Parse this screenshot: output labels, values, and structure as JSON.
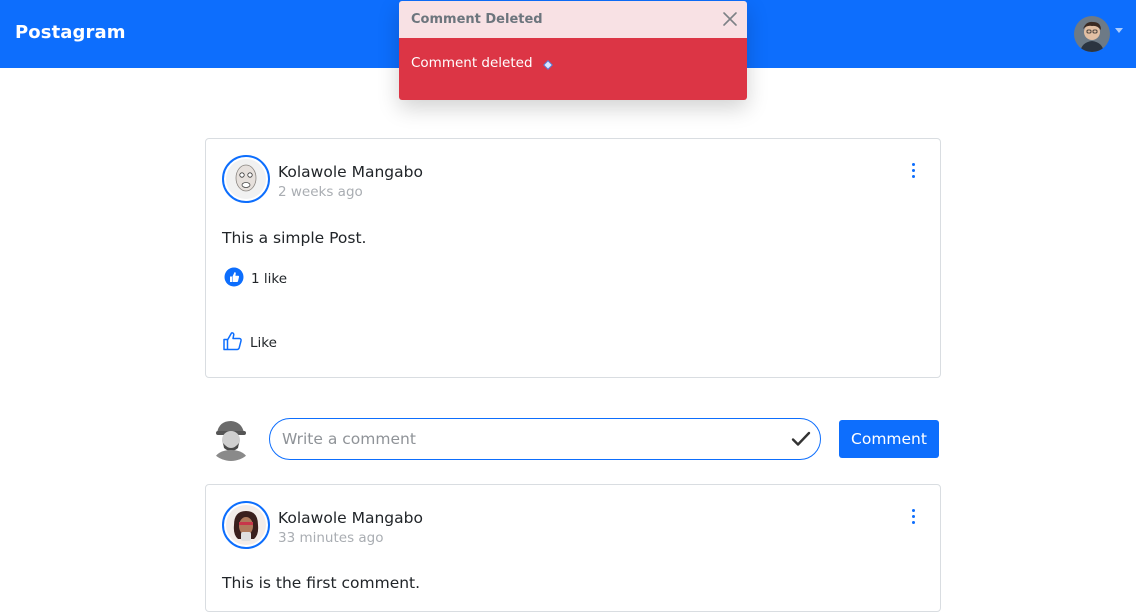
{
  "navbar": {
    "brand": "Postagram",
    "avatar_icon": "user-avatar-icon",
    "caret_icon": "caret-down-icon"
  },
  "toast": {
    "title": "Comment Deleted",
    "message": "Comment deleted",
    "emoji_icon": "sparkle-icon",
    "close_icon": "close-icon",
    "colors": {
      "header_bg": "#f8e1e4",
      "body_bg": "#dc3545"
    }
  },
  "post": {
    "author": "Kolawole Mangabo",
    "time": "2 weeks ago",
    "body": "This a simple Post.",
    "likes_label": "1 like",
    "like_action_label": "Like"
  },
  "comment_form": {
    "placeholder": "Write a comment",
    "submit_label": "Comment"
  },
  "comment": {
    "author": "Kolawole Mangabo",
    "time": "33 minutes ago",
    "body": "This is the first comment."
  },
  "colors": {
    "accent": "#0d6efd",
    "card_border": "#d9dde1",
    "muted_text": "#a9adb2"
  }
}
